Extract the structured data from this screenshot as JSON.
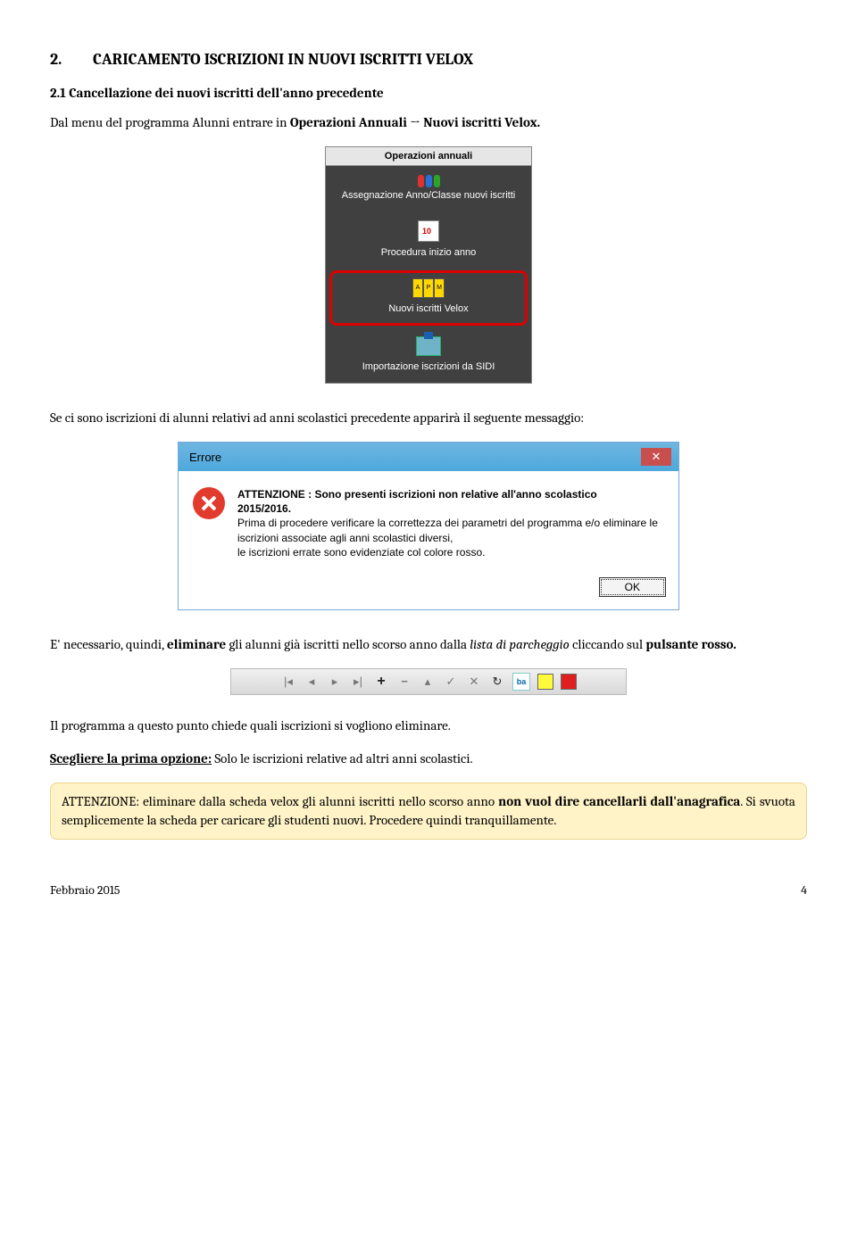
{
  "section": {
    "num": "2.",
    "title": "CARICAMENTO ISCRIZIONI IN NUOVI ISCRITTI VELOX"
  },
  "sub": "2.1 Cancellazione dei nuovi iscritti dell'anno precedente",
  "p1a": "Dal menu del programma Alunni entrare in ",
  "p1b": "Operazioni Annuali → Nuovi iscritti Velox.",
  "menu": {
    "title": "Operazioni annuali",
    "item1": "Assegnazione Anno/Classe nuovi iscritti",
    "item2": "Procedura inizio anno",
    "item3": "Nuovi iscritti Velox",
    "item4": "Importazione iscrizioni da SIDI"
  },
  "p2": "Se ci sono iscrizioni di alunni relativi ad anni scolastici precedente apparirà il seguente messaggio:",
  "err": {
    "title": "Errore",
    "l1a": "ATTENZIONE : Sono presenti iscrizioni non relative all'anno scolastico ",
    "l1b": "2015/2016.",
    "l2": "Prima di procedere verificare la correttezza dei parametri del programma e/o eliminare le iscrizioni associate agli anni scolastici diversi,",
    "l3": "le iscrizioni errate sono evidenziate col colore rosso.",
    "ok": "OK"
  },
  "p3a": "E' necessario, quindi, ",
  "p3b": "eliminare",
  "p3c": " gli alunni già iscritti nello scorso anno dalla ",
  "p3d": "lista di parcheggio",
  "p3e": " cliccando sul ",
  "p3f": "pulsante rosso.",
  "toolbar": {
    "ba": "ba"
  },
  "p4": "Il programma a questo punto chiede quali iscrizioni si vogliono eliminare.",
  "p5a": "Scegliere la prima opzione:",
  "p5b": " Solo le iscrizioni relative ad altri anni scolastici.",
  "warn": {
    "a": "ATTENZIONE: eliminare dalla scheda velox gli alunni iscritti nello scorso anno ",
    "b": "non vuol dire cancellarli dall'anagrafica",
    "c": ". Si svuota semplicemente la scheda per caricare gli studenti nuovi. Procedere quindi tranquillamente."
  },
  "footer": {
    "left": "Febbraio 2015",
    "right": "4"
  }
}
